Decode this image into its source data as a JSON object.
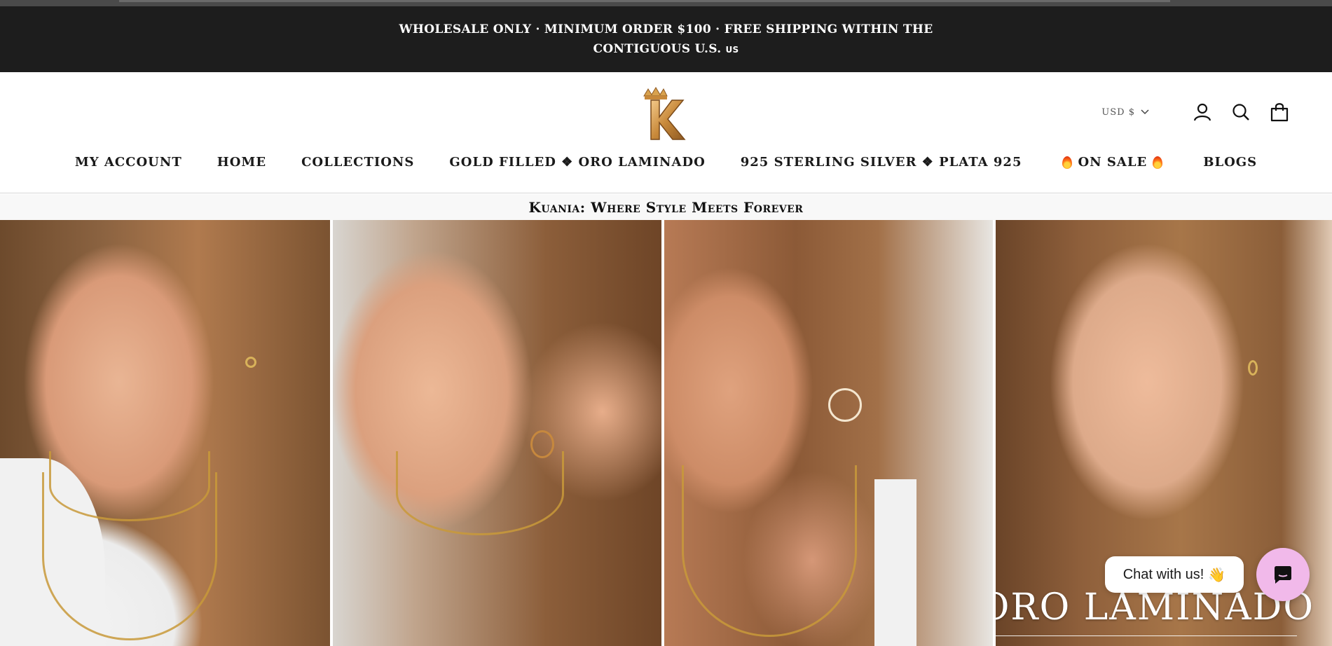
{
  "announcement": {
    "line1": "WHOLESALE ONLY · MINIMUM ORDER $100 · FREE SHIPPING WITHIN THE",
    "line2": "CONTIGUOUS U.S.",
    "country": "US"
  },
  "header": {
    "logo_letter": "K",
    "currency": "USD $",
    "icons": [
      "account-icon",
      "search-icon",
      "cart-icon"
    ]
  },
  "nav": {
    "items": [
      {
        "label": "MY ACCOUNT"
      },
      {
        "label": "HOME"
      },
      {
        "label": "COLLECTIONS"
      },
      {
        "label": "GOLD FILLED ❖ ORO LAMINADO"
      },
      {
        "label": "925 STERLING SILVER ❖ PLATA 925"
      },
      {
        "label": "ON SALE"
      },
      {
        "label": "BLOGS"
      }
    ]
  },
  "tagline": "Kuania: Where Style Meets Forever",
  "hero": {
    "title": "ORO LAMINADO"
  },
  "chat": {
    "label": "Chat with us!",
    "emoji": "👋"
  },
  "colors": {
    "announcement_bg": "#1d1d1d",
    "chat_button": "#f1b9ea",
    "logo_gold": "#c8893a"
  }
}
